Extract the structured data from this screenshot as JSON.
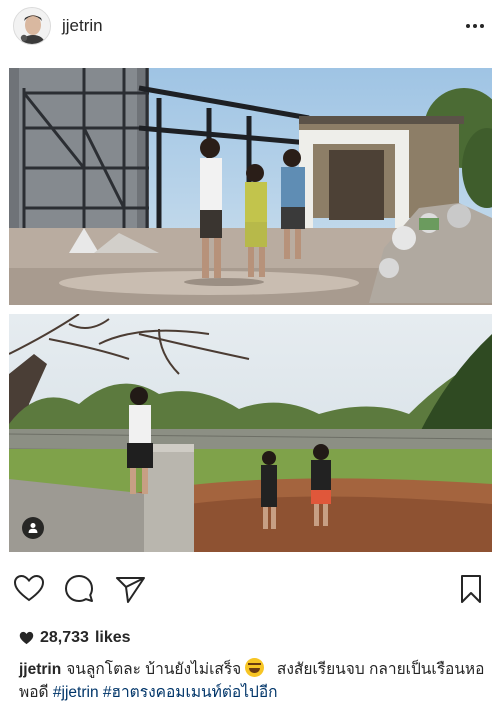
{
  "post": {
    "username": "jjetrin",
    "likes_count": "28,733",
    "likes_suffix": "likes",
    "caption": {
      "username": "jjetrin",
      "text_part1": "จนลูกโตละ บ้านยังไม่เสร็จ",
      "emoji_name": "face-with-tears-of-joy",
      "text_part2": "สงสัยเรียนจบ กลายเป็นเรือนหอพอดี",
      "hashtags": [
        "#jjetrin",
        "#ฮาตรงคอมเมนท์ต่อไปอีก"
      ]
    }
  },
  "icons": {
    "more": "more-options-icon",
    "like": "heart-icon",
    "comment": "comment-icon",
    "share": "paper-plane-icon",
    "save": "bookmark-icon",
    "tagged": "person-icon"
  },
  "colors": {
    "text": "#262626",
    "hashtag": "#003569",
    "background": "#ffffff"
  }
}
